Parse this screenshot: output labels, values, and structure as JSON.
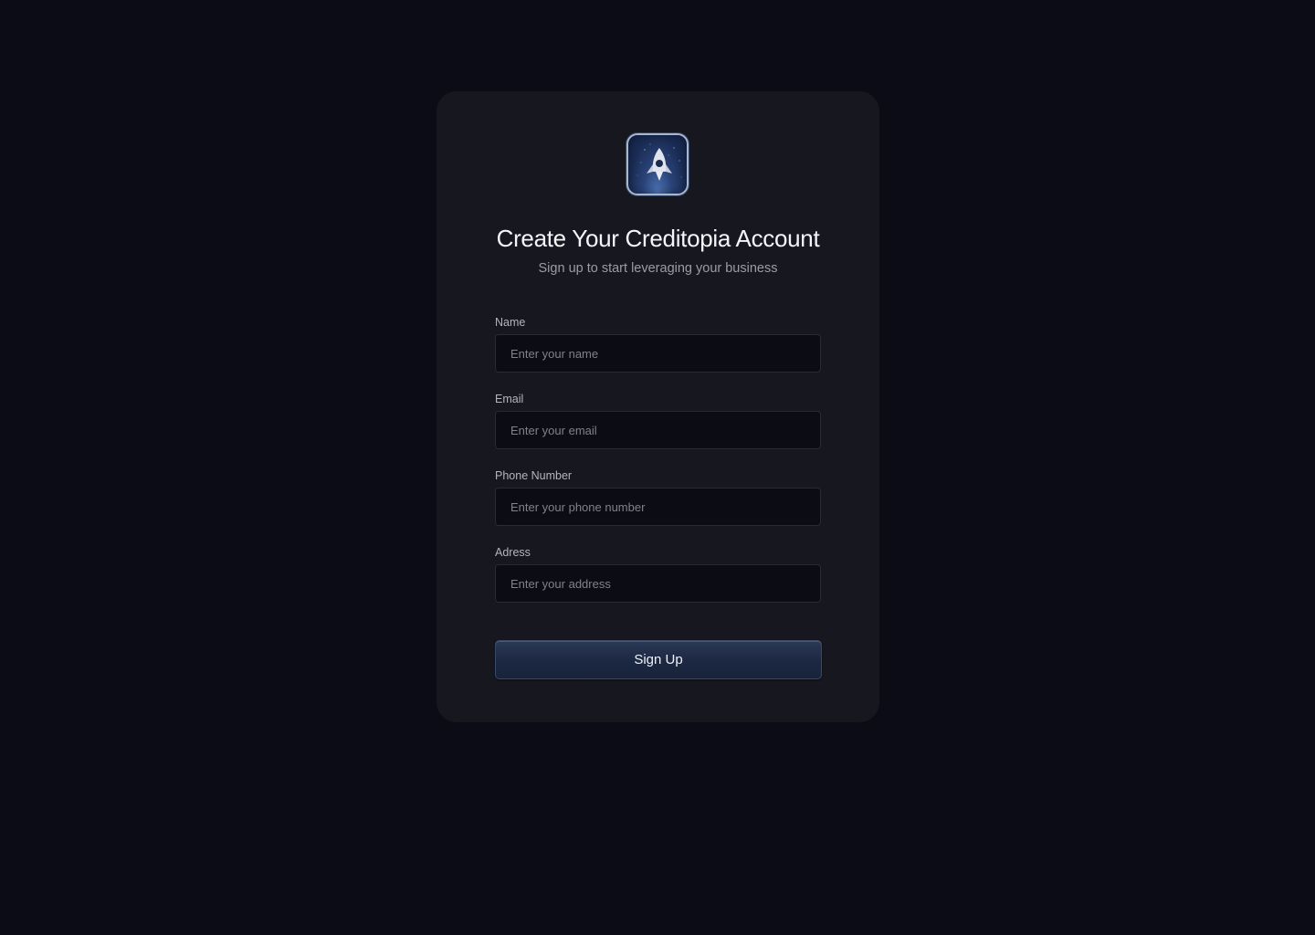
{
  "logo": {
    "icon": "rocket-icon"
  },
  "header": {
    "title": "Create Your Creditopia Account",
    "subtitle": "Sign up to start leveraging your business"
  },
  "form": {
    "name": {
      "label": "Name",
      "placeholder": "Enter your name",
      "value": ""
    },
    "email": {
      "label": "Email",
      "placeholder": "Enter your email",
      "value": ""
    },
    "phone": {
      "label": "Phone Number",
      "placeholder": "Enter your phone number",
      "value": ""
    },
    "address": {
      "label": "Adress",
      "placeholder": "Enter your address",
      "value": ""
    },
    "submit_label": "Sign Up"
  },
  "colors": {
    "page_background": "#0b0c15",
    "card_background": "#17181f",
    "button_background": "#1c2842",
    "input_background": "#0b0c14"
  }
}
